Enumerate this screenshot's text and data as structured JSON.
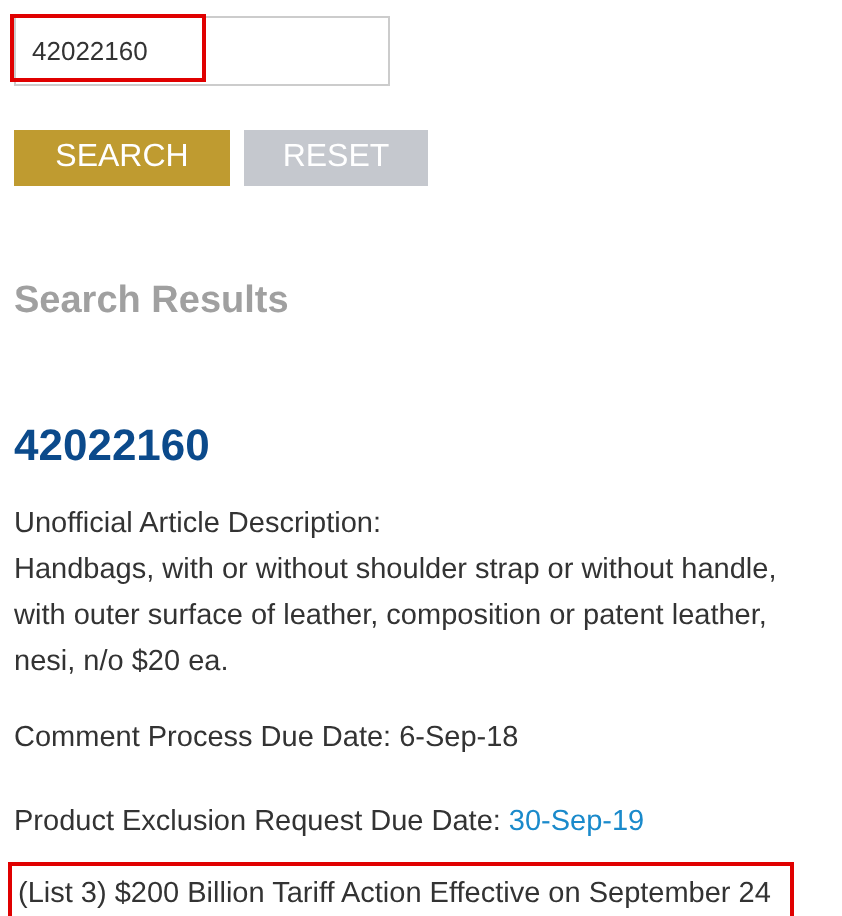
{
  "search": {
    "value": "42022160",
    "highlighted": true
  },
  "buttons": [
    {
      "label": "SEARCH",
      "kind": "primary"
    },
    {
      "label": "RESET",
      "kind": "secondary"
    }
  ],
  "results_title": "Search Results",
  "result": {
    "code": "42022160",
    "description_label": "Unofficial Article Description:",
    "description": "Handbags, with or without shoulder strap or without handle, with outer surface of leather, composition or patent leather, nesi, n/o $20 ea.",
    "comment_due": "Comment Process Due Date: 6-Sep-18",
    "exclusion_due_label": "Product Exclusion Request Due Date:",
    "exclusion_due_date": "30-Sep-19",
    "notice": {
      "text": "(List 3) $200 Billion Tariff Action Effective on September 24",
      "highlighted": true
    }
  }
}
